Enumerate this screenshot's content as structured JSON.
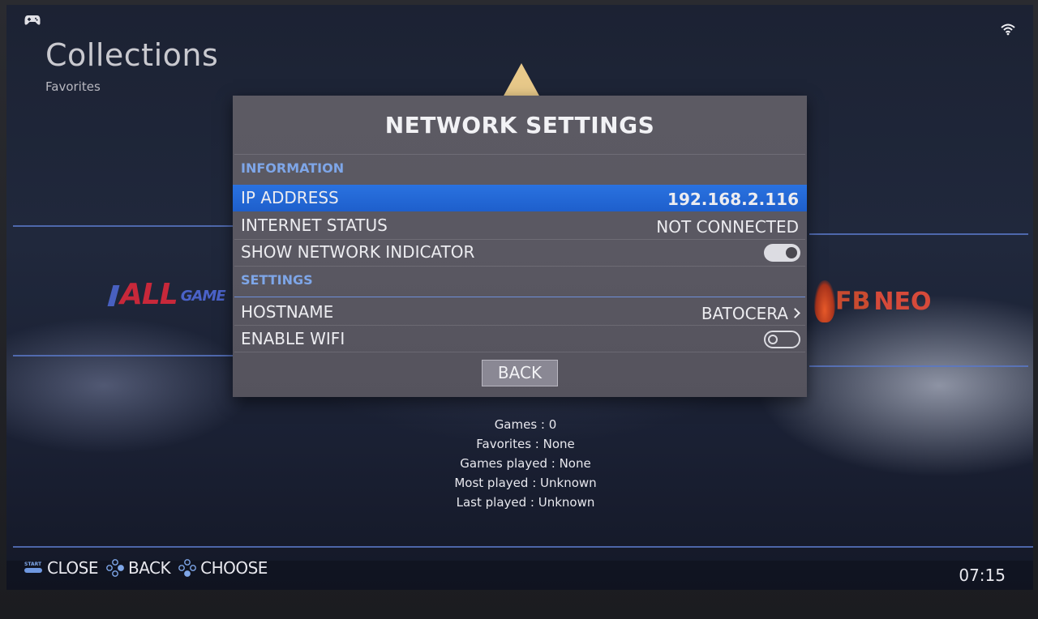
{
  "header": {
    "collection_title": "Collections",
    "collection_subtitle": "Favorites",
    "gamepad_icon": "gamepad-icon",
    "wifi_icon": "wifi-icon"
  },
  "background_logos": {
    "left": {
      "main": "ALL",
      "suffix": "GAME"
    },
    "right": {
      "main": "FB",
      "suffix": "NEO"
    }
  },
  "dialog": {
    "title": "NETWORK SETTINGS",
    "sections": [
      {
        "header": "INFORMATION"
      },
      {
        "header": "SETTINGS"
      }
    ],
    "rows": {
      "ip_address": {
        "label": "IP ADDRESS",
        "value": "192.168.2.116",
        "selected": true
      },
      "internet_status": {
        "label": "INTERNET STATUS",
        "value": "NOT CONNECTED"
      },
      "show_network_indicator": {
        "label": "SHOW NETWORK INDICATOR",
        "toggle": true
      },
      "hostname": {
        "label": "HOSTNAME",
        "value": "BATOCERA"
      },
      "enable_wifi": {
        "label": "ENABLE WIFI",
        "toggle": false
      }
    },
    "back_label": "BACK"
  },
  "stats": {
    "games": "Games : 0",
    "favorites": "Favorites : None",
    "games_played": "Games played : None",
    "most_played": "Most played : Unknown",
    "last_played": "Last played : Unknown"
  },
  "help_bar": {
    "start_label": "START",
    "close": "CLOSE",
    "back": "BACK",
    "choose": "CHOOSE"
  },
  "clock": "07:15",
  "colors": {
    "selection": "#1e5fcc",
    "section_header": "#7ea6e8",
    "dialog_bg": "#5a5862"
  }
}
